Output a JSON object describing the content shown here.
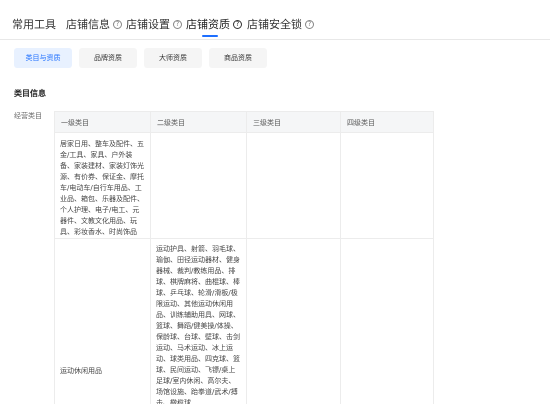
{
  "nav": {
    "tabs": [
      {
        "label": "常用工具",
        "has_help": false
      },
      {
        "label": "店铺信息",
        "has_help": true
      },
      {
        "label": "店铺设置",
        "has_help": true
      },
      {
        "label": "店铺资质",
        "has_help": true,
        "active": true
      },
      {
        "label": "店铺安全锁",
        "has_help": true
      }
    ],
    "help_glyph": "?"
  },
  "subtabs": [
    {
      "label": "类目与资质",
      "active": true
    },
    {
      "label": "品牌资质",
      "active": false
    },
    {
      "label": "大师资质",
      "active": false
    },
    {
      "label": "商品资质",
      "active": false
    }
  ],
  "section": {
    "title": "类目信息",
    "row_label": "经营类目"
  },
  "table": {
    "headers": [
      "一级类目",
      "二级类目",
      "三级类目",
      "四级类目"
    ],
    "rows": [
      {
        "level1": "居家日用、整车及配件、五金/工具、家具、户外装备、家装建材、家装灯饰光源、有价券、保证金、摩托车/电动车/自行车用品、工业品、箱包、乐器及配件、个人护理、电子/电工、元器件、文教文化用品、玩具、彩妆香水、时尚饰品",
        "level2": "",
        "level3": "",
        "level4": ""
      },
      {
        "level1": "运动休闲用品",
        "level2": "运动护具、射箭、羽毛球、瑜伽、田径运动器材、健身器械、裁判/教练用品、排球、棋牌麻将、曲棍球、棒球、乒乓球、轮滑/滑板/极限运动、其他运动休闲用品、训练辅助用具、网球、篮球、舞蹈/健美操/体操、保龄球、台球、壁球、击剑运动、马术运动、冰上运动、球类用品、四克球、篮球、民间运动、飞镖/桌上足球/室内休闲、高尔夫、场馆设施、跆拳道/武术/搏击、橄榄球",
        "level3": "",
        "level4": ""
      }
    ]
  },
  "colors": {
    "accent": "#1e6fff",
    "subtab_active_bg": "#e8f1ff",
    "header_bg": "#f5f6f7",
    "border": "#ececec"
  }
}
